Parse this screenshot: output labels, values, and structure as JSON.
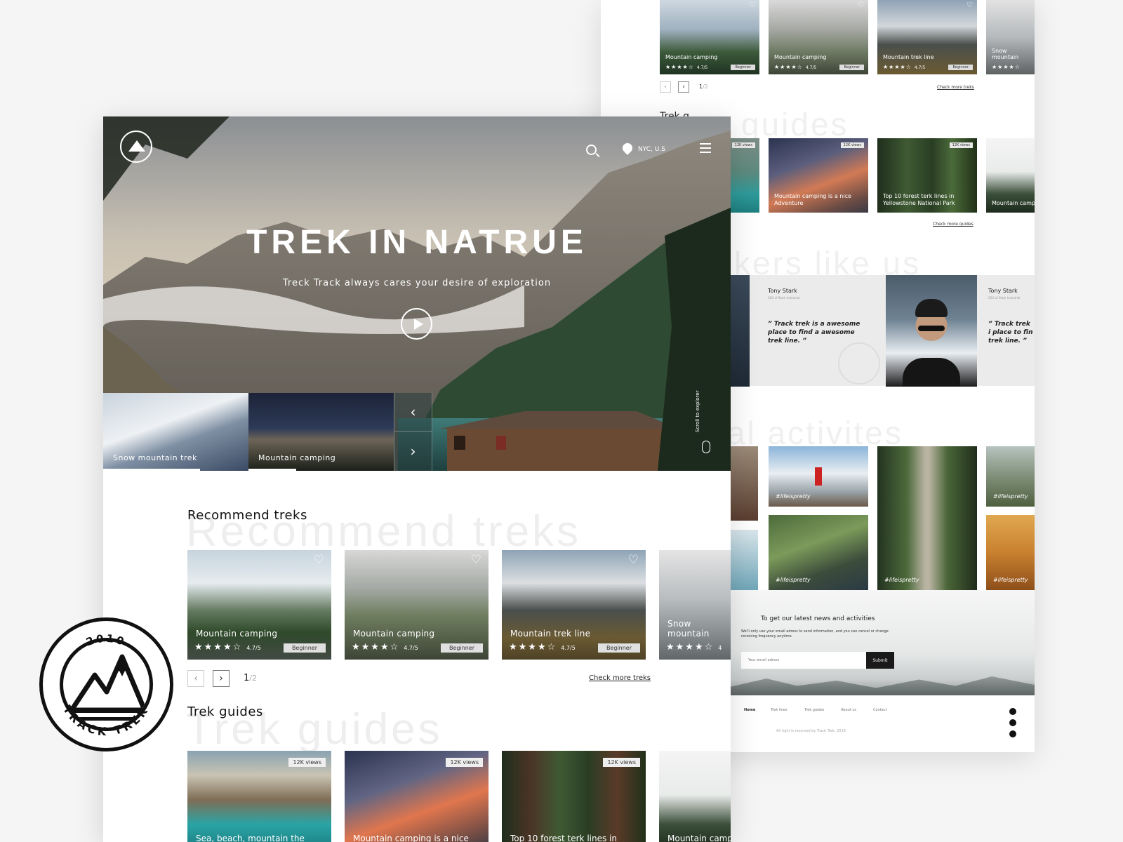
{
  "brand": {
    "badge_year": "2010",
    "badge_text": "TRACK TREK"
  },
  "colors": {
    "accent_dark": "#1a1a1a",
    "hero_sky": "#b9b2a6",
    "forest": "#2f4a33",
    "lake": "#4f8a86"
  },
  "hero": {
    "title": "TREK IN NATRUE",
    "subtitle": "Treck Track always cares your desire of exploration",
    "location": "NYC, U.S",
    "scroll_label": "Scroll to explorer",
    "thumbs": [
      "Snow mountain trek",
      "Mountain camping"
    ],
    "icons": [
      "search-icon",
      "location-pin-icon",
      "menu-icon",
      "play-icon",
      "chevron-left-icon",
      "chevron-right-icon",
      "mouse-icon"
    ]
  },
  "recommend": {
    "title": "Recommend treks",
    "ghost": "Recommend treks",
    "cards": [
      {
        "name": "Mountain camping",
        "rating": "4.7/5",
        "level": "Beginner"
      },
      {
        "name": "Mountain camping",
        "rating": "4.7/5",
        "level": "Beginner"
      },
      {
        "name": "Mountain trek line",
        "rating": "4.7/5",
        "level": "Beginner"
      },
      {
        "name": "Snow mountain",
        "rating": "4",
        "level": ""
      }
    ],
    "stars": "★★★★☆",
    "page_current": "1",
    "page_total": "/2",
    "more_link": "Check more treks"
  },
  "guides": {
    "title": "Trek guides",
    "ghost": "Trek guides",
    "cards": [
      {
        "name": "Sea, beach, mountain the",
        "views": "12K views"
      },
      {
        "name": "Mountain camping is a nice",
        "views": "12K views"
      },
      {
        "name": "Top 10 forest terk lines in",
        "views": "12K views"
      },
      {
        "name": "Mountain camp",
        "views": ""
      }
    ]
  },
  "back": {
    "treks": [
      {
        "name": "Mountain camping",
        "rating": "4.7/5",
        "level": "Beginner"
      },
      {
        "name": "Mountain camping",
        "rating": "4.7/5",
        "level": "Beginner"
      },
      {
        "name": "Mountain trek line",
        "rating": "4.7/5",
        "level": "Beginner"
      },
      {
        "name": "Snow mountain",
        "rating": "",
        "level": ""
      }
    ],
    "page": "1",
    "page_total": "/2",
    "more_treks": "Check more treks",
    "guides_ghost": "guides",
    "guides_partial_title": "Trek g",
    "guides": [
      {
        "name": "the",
        "views": "12K views"
      },
      {
        "name": "Mountain camping is a nice Adventure",
        "views": "12K views"
      },
      {
        "name": "Top 10 forest terk lines in Yellowstone National Park",
        "views": "12K views"
      },
      {
        "name": "Mountain camp Adventure",
        "views": ""
      }
    ],
    "more_guides": "Check more guides",
    "hikers_ghost": "kers like us",
    "testimonials": [
      {
        "name": "Tony Stark",
        "role": "CEO of Stark Industrial",
        "quote": "”  Track trek is a awesome place to find a awesome trek line.  ”"
      },
      {
        "name": "Tony Stark",
        "role": "CEO of Stark Industrial",
        "quote": "”  Track trek i place to fin trek line.  ”"
      }
    ],
    "activities_ghost": "al activites",
    "activity_tags": [
      "#lifeispretty",
      "#lifeispretty",
      "#lifeispretty",
      "#lifeispretty",
      "#lifeispretty"
    ],
    "newsletter": {
      "title": "To get our latest news and activities",
      "body": "We'll only use your email adress to send information, and you can cancel or change receiving frequency anytime",
      "placeholder": "Your email adress",
      "submit": "Submit"
    },
    "footer": {
      "nav": [
        "Home",
        "Trek lines",
        "Trek guides",
        "About us",
        "Contact"
      ],
      "copyright": "All right is reserved by Track Trek, 2018",
      "social": [
        "instagram-icon",
        "youtube-icon",
        "facebook-icon"
      ]
    }
  }
}
